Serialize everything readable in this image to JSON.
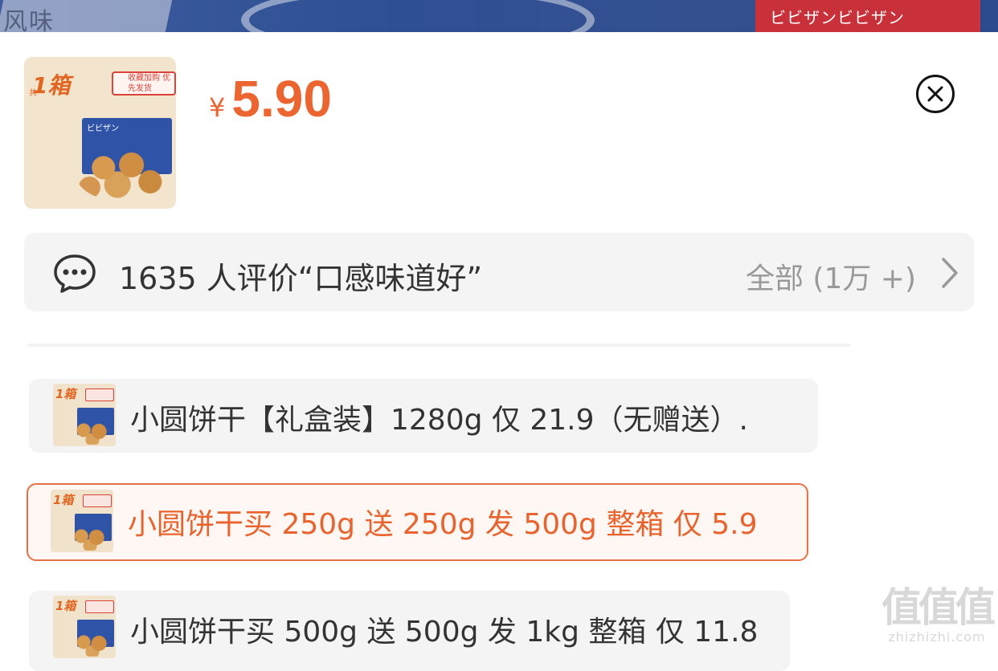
{
  "banner": {
    "left_text": "风味",
    "right_text": "ビビザンビビザン"
  },
  "product": {
    "thumbnail": {
      "tag": "1箱",
      "tag_prefix": "共",
      "badge": "收藏加购 优先发货",
      "box_label": "ビビザン"
    },
    "price": {
      "symbol": "¥",
      "amount": "5.90"
    }
  },
  "close_icon": "close-circle-icon",
  "reviews": {
    "icon": "chat-bubble-icon",
    "summary": "1635 人评价“口感味道好”",
    "all_label": "全部 (1万 +)",
    "chevron_icon": "chevron-right-icon"
  },
  "options": [
    {
      "label": "小圆饼干【礼盒装】1280g 仅 21.9（无赠送）.",
      "thumb_tag": "1箱",
      "selected": false
    },
    {
      "label": "小圆饼干买 250g 送 250g 发 500g 整箱  仅 5.9",
      "thumb_tag": "1箱",
      "selected": true
    },
    {
      "label": "小圆饼干买 500g 送 500g 发 1kg 整箱  仅 11.8",
      "thumb_tag": "1箱",
      "selected": false
    }
  ],
  "watermark": {
    "logo": "值值值",
    "url": "zhizhizhi.com"
  },
  "colors": {
    "accent": "#ec6530",
    "selected_border": "#e87046",
    "row_bg": "#f4f4f4"
  }
}
